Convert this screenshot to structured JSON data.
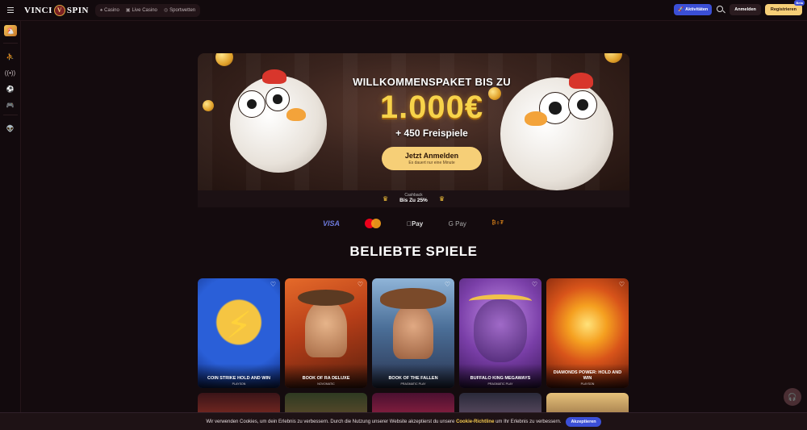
{
  "header": {
    "logo_left": "VINCI",
    "logo_right": "SPIN",
    "nav": [
      {
        "label": "Casino",
        "icon": "spade-icon"
      },
      {
        "label": "Live Casino",
        "icon": "cards-icon"
      },
      {
        "label": "Sportwetten",
        "icon": "ball-icon"
      }
    ],
    "activities_label": "Aktivitäten",
    "login_label": "Anmelden",
    "register_label": "Registrieren",
    "register_tag": "Beta"
  },
  "sidebar": {
    "icons": [
      "avatar",
      "basketball-icon",
      "live-icon",
      "soccer-icon",
      "gamepad-icon",
      "alien-icon"
    ]
  },
  "hero": {
    "welcome": "WILLKOMMENSPAKET BIS ZU",
    "amount": "1.000€",
    "spins": "+ 450 Freispiele",
    "cta_label": "Jetzt Anmelden",
    "cta_sub": "Es dauert nur eine Minute"
  },
  "cashback": {
    "label": "Cashback",
    "value": "Bis Zu 25%"
  },
  "payments": [
    "VISA",
    "Mastercard",
    "Apple Pay",
    "G Pay",
    "Crypto"
  ],
  "payment_text": {
    "visa": "VISA",
    "apple": "Pay",
    "gpay": "G Pay",
    "crypto": "₿⬨₮"
  },
  "popular": {
    "title": "BELIEBTE SPIELE",
    "games": [
      {
        "name": "COIN STRIKE HOLD AND WIN",
        "provider": "PLAYSON",
        "color": "#0e3a9a"
      },
      {
        "name": "BOOK OF RA DELUXE",
        "provider": "NOVOMATIC",
        "color": "#c4531d"
      },
      {
        "name": "BOOK OF THE FALLEN",
        "provider": "PRAGMATIC PLAY",
        "color": "#4a6fa0"
      },
      {
        "name": "BUFFALO KING MEGAWAYS",
        "provider": "PRAGMATIC PLAY",
        "color": "#7a3fa8"
      },
      {
        "name": "DIAMONDS POWER: HOLD AND WIN",
        "provider": "PLAYSON",
        "color": "#d8541a"
      }
    ]
  },
  "cookie": {
    "text_before": "Wir verwenden Cookies, um dein Erlebnis zu verbessern. Durch die Nutzung unserer Website akzeptierst du unsere",
    "link": "Cookie-Richtline",
    "text_after": "um Ihr Erlebnis zu verbessern.",
    "accept_label": "Akzeptieren"
  }
}
